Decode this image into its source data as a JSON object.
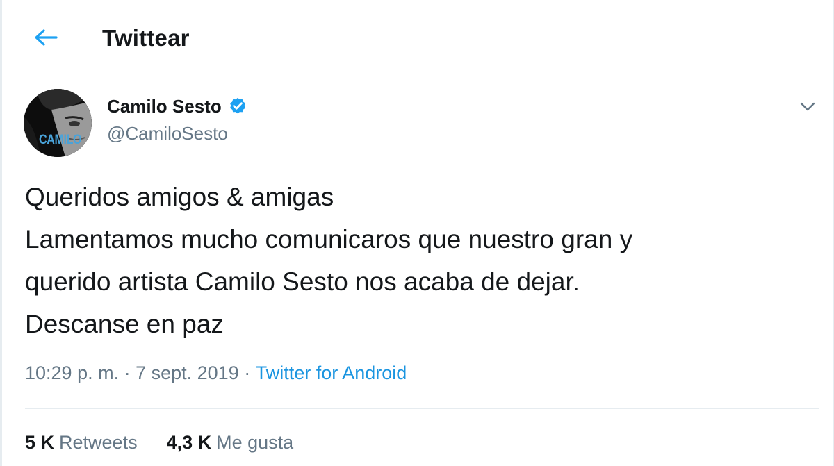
{
  "header": {
    "title": "Twittear"
  },
  "tweet": {
    "avatar_text": "CAMILO",
    "display_name": "Camilo Sesto",
    "handle": "@CamiloSesto",
    "text_lines": [
      "Queridos amigos & amigas",
      "Lamentamos mucho comunicaros que nuestro gran y",
      "querido artista Camilo Sesto nos acaba de dejar.",
      "Descanse en paz"
    ],
    "time": "10:29 p. m.",
    "separator": " · ",
    "date": "7 sept. 2019",
    "source": "Twitter for Android",
    "retweets_count": "5 K",
    "retweets_label": "Retweets",
    "likes_count": "4,3 K",
    "likes_label": "Me gusta"
  },
  "colors": {
    "accent": "#1da1f2",
    "text": "#14171a",
    "muted": "#657786",
    "verified": "#1da1f2"
  },
  "icons": {
    "back": "arrow-left-icon",
    "verified": "verified-badge-icon",
    "more": "chevron-down-icon"
  }
}
